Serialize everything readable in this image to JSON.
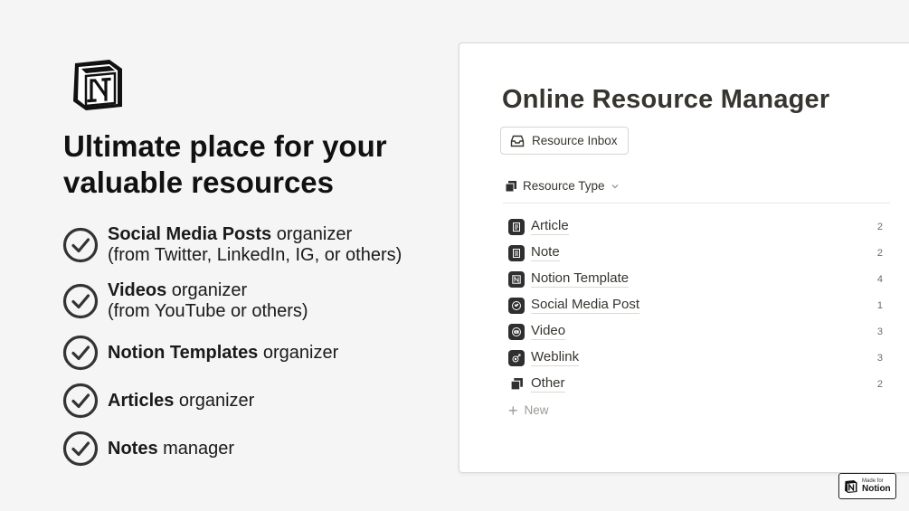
{
  "left": {
    "headline_line1": "Ultimate place for your",
    "headline_line2": "valuable resources",
    "features": [
      {
        "bold": "Social Media Posts",
        "rest": " organizer",
        "sub": "(from Twitter, LinkedIn, IG, or others)"
      },
      {
        "bold": "Videos",
        "rest": " organizer",
        "sub": "(from YouTube or others)"
      },
      {
        "bold": "Notion Templates",
        "rest": " organizer",
        "sub": ""
      },
      {
        "bold": "Articles",
        "rest": " organizer",
        "sub": ""
      },
      {
        "bold": "Notes",
        "rest": " manager",
        "sub": ""
      }
    ]
  },
  "card": {
    "title": "Online Resource Manager",
    "inbox_label": "Resource Inbox",
    "group_label": "Resource Type",
    "rows": [
      {
        "label": "Article",
        "count": "2",
        "icon": "document-icon"
      },
      {
        "label": "Note",
        "count": "2",
        "icon": "note-icon"
      },
      {
        "label": "Notion Template",
        "count": "4",
        "icon": "notion-icon"
      },
      {
        "label": "Social Media Post",
        "count": "1",
        "icon": "twitter-icon"
      },
      {
        "label": "Video",
        "count": "3",
        "icon": "youtube-icon"
      },
      {
        "label": "Weblink",
        "count": "3",
        "icon": "link-icon"
      },
      {
        "label": "Other",
        "count": "2",
        "icon": "stack-icon"
      }
    ],
    "new_label": "New"
  },
  "badge": {
    "small": "Made for",
    "big": "Notion"
  },
  "colors": {
    "background": "#f5f5f5",
    "text_dark": "#37352f",
    "icon_dark": "#2f2f2f"
  }
}
